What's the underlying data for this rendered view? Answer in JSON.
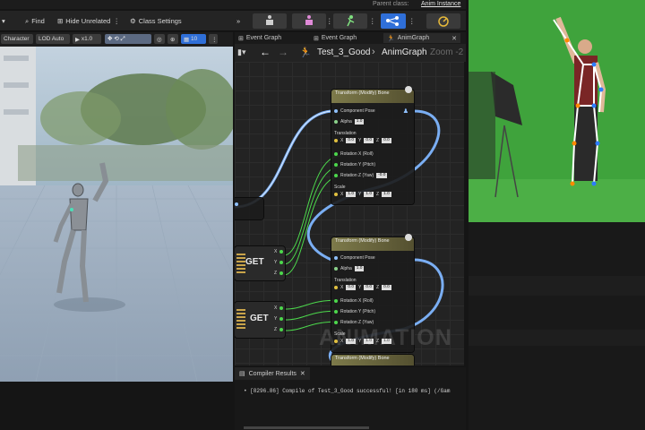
{
  "topbar": {
    "parent_class_label": "Parent class:",
    "parent_class_value": "Anim Instance"
  },
  "toolbar": {
    "find_label": "Find",
    "hide_unrelated_label": "Hide Unrelated",
    "class_settings_label": "Class Settings"
  },
  "viewport_bar": {
    "mode": "Character",
    "lod": "LOD Auto",
    "play_speed": "x1.0",
    "camera_speed": "10"
  },
  "graph_tabs": [
    {
      "label": "Event Graph"
    },
    {
      "label": "Event Graph"
    },
    {
      "label": "AnimGraph"
    }
  ],
  "breadcrumb": {
    "asset": "Test_3_Good",
    "graph": "AnimGraph",
    "zoom": "Zoom -2"
  },
  "nodes": {
    "node1": {
      "title": "Transform (Modify) Bone",
      "component_pose": "Component Pose",
      "alpha": "Alpha",
      "alpha_value": "1.0",
      "translation": "Translation",
      "translation_values": [
        "0.0",
        "0.0",
        "0.0"
      ],
      "rot_x": "Rotation X (Roll)",
      "rot_y": "Rotation Y (Pitch)",
      "rot_z": "Rotation Z (Yaw)",
      "rot_z_value": "-0.0",
      "scale": "Scale",
      "scale_values": [
        "1.0",
        "1.0",
        "1.0"
      ]
    },
    "node2": {
      "title": "Transform (Modify) Bone",
      "component_pose": "Component Pose",
      "alpha": "Alpha",
      "alpha_value": "1.0",
      "translation": "Translation",
      "translation_values": [
        "0.0",
        "0.0",
        "0.0"
      ],
      "rot_x": "Rotation X (Roll)",
      "rot_y": "Rotation Y (Pitch)",
      "rot_z": "Rotation Z (Yaw)",
      "scale": "Scale",
      "scale_values": [
        "1.0",
        "1.0",
        "1.0"
      ]
    },
    "node3": {
      "title": "Transform (Modify) Bone"
    }
  },
  "get_nodes": [
    {
      "label": "GET",
      "pins": [
        "X",
        "Y",
        "Z"
      ]
    },
    {
      "label": "GET",
      "pins": [
        "X",
        "Y",
        "Z"
      ]
    }
  ],
  "watermark": "ANIMATION",
  "compiler": {
    "tab_label": "Compiler Results",
    "message": "• [8296.86] Compile of Test_3_Good successful! [in 180 ms] (/Gam"
  },
  "colors": {
    "accent": "#2f6fd8",
    "exec_green": "#4cd84c",
    "wire_blue": "#7fb6ff",
    "node_header": "#7d7a4a"
  }
}
